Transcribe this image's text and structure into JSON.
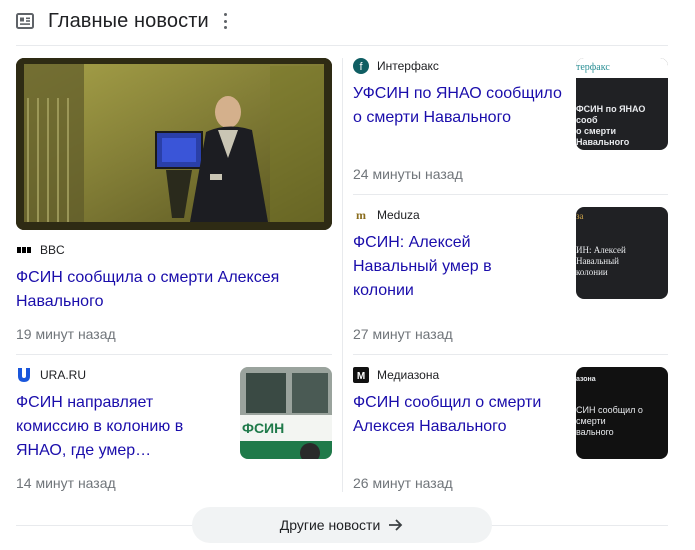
{
  "header": {
    "title": "Главные новости"
  },
  "big_story": {
    "source": "BBC",
    "headline": "ФСИН сообщила о смерти Алексея Навального",
    "time": "19 минут назад"
  },
  "small_story": {
    "source": "URA.RU",
    "headline": "ФСИН направляет комиссию в колонию в ЯНАО, где умер…",
    "time": "14 минут назад",
    "thumb_text": "ФСИН"
  },
  "right_stories": [
    {
      "source": "Интерфакс",
      "headline": "УФСИН по ЯНАО сообщило о смерти Навального",
      "time": "24 минуты назад",
      "thumb_brand": "терфакс",
      "thumb_text": "ФСИН по ЯНАО сооб\nо смерти Навального"
    },
    {
      "source": "Meduza",
      "headline": "ФСИН: Алексей Навальный умер в колонии",
      "time": "27 минут назад",
      "thumb_brand": "за",
      "thumb_text": "ИН: Алексей Навальный\nколонии"
    },
    {
      "source": "Медиазона",
      "headline": "ФСИН сообщил о смерти Алексея Навального",
      "time": "26 минут назад",
      "thumb_brand": "азона",
      "thumb_text": "СИН сообщил о смерти\nвального"
    }
  ],
  "more_button": {
    "label": "Другие новости"
  },
  "colors": {
    "link": "#1a0dab",
    "meta": "#70757a",
    "divider": "#e8eaed",
    "button_bg": "#f1f3f4"
  },
  "icons": [
    "news-icon",
    "more-vert-icon",
    "arrow-right-icon"
  ]
}
